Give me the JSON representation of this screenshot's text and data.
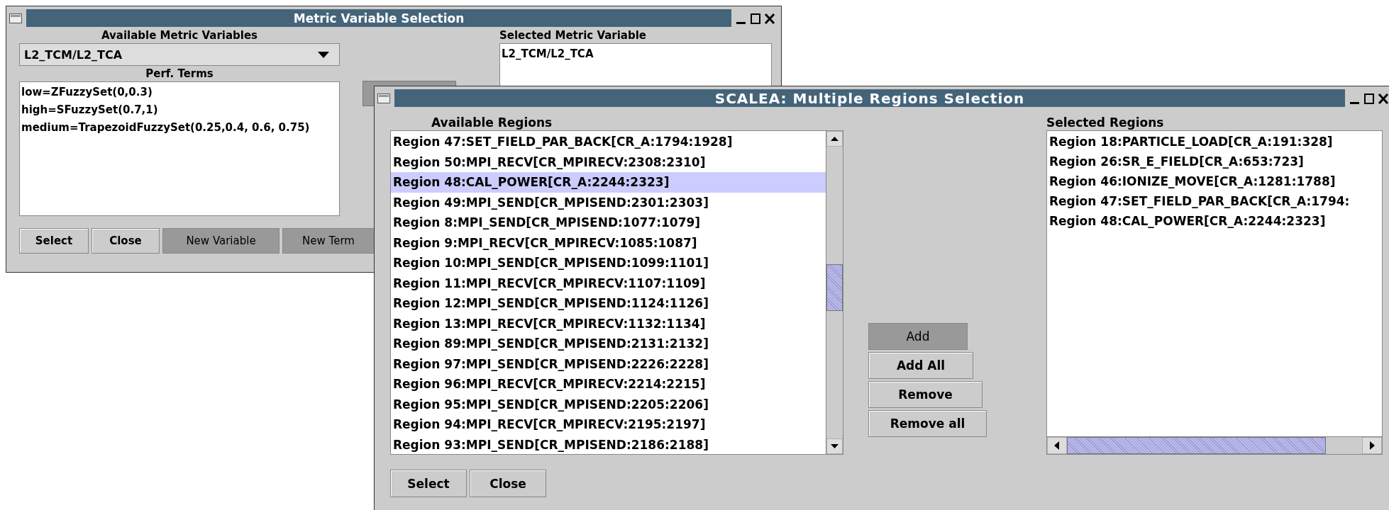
{
  "back_window": {
    "title": "Metric Variable Selection",
    "available_label": "Available Metric Variables",
    "dropdown": {
      "value": "L2_TCM/L2_TCA"
    },
    "perf_terms_label": "Perf. Terms",
    "perf_terms": [
      "low=ZFuzzySet(0,0.3)",
      "high=SFuzzySet(0.7,1)",
      "medium=TrapezoidFuzzySet(0.25,0.4, 0.6, 0.75)"
    ],
    "buttons": [
      {
        "label": "Select",
        "pressed": false
      },
      {
        "label": "Close",
        "pressed": false
      },
      {
        "label": "New Variable",
        "pressed": true
      },
      {
        "label": "New Term",
        "pressed": true
      }
    ],
    "selected_label": "Selected Metric Variable",
    "selected_items": [
      "L2_TCM/L2_TCA"
    ]
  },
  "front_window": {
    "title": "SCALEA: Multiple Regions Selection",
    "available_label": "Available Regions",
    "available_regions": [
      {
        "label": "Region 47:SET_FIELD_PAR_BACK[CR_A:1794:1928]",
        "selected": false
      },
      {
        "label": "Region 50:MPI_RECV[CR_MPIRECV:2308:2310]",
        "selected": false
      },
      {
        "label": "Region 48:CAL_POWER[CR_A:2244:2323]",
        "selected": true
      },
      {
        "label": "Region 49:MPI_SEND[CR_MPISEND:2301:2303]",
        "selected": false
      },
      {
        "label": "Region 8:MPI_SEND[CR_MPISEND:1077:1079]",
        "selected": false
      },
      {
        "label": "Region 9:MPI_RECV[CR_MPIRECV:1085:1087]",
        "selected": false
      },
      {
        "label": "Region 10:MPI_SEND[CR_MPISEND:1099:1101]",
        "selected": false
      },
      {
        "label": "Region 11:MPI_RECV[CR_MPIRECV:1107:1109]",
        "selected": false
      },
      {
        "label": "Region 12:MPI_SEND[CR_MPISEND:1124:1126]",
        "selected": false
      },
      {
        "label": "Region 13:MPI_RECV[CR_MPIRECV:1132:1134]",
        "selected": false
      },
      {
        "label": "Region 89:MPI_SEND[CR_MPISEND:2131:2132]",
        "selected": false
      },
      {
        "label": "Region 97:MPI_SEND[CR_MPISEND:2226:2228]",
        "selected": false
      },
      {
        "label": "Region 96:MPI_RECV[CR_MPIRECV:2214:2215]",
        "selected": false
      },
      {
        "label": "Region 95:MPI_SEND[CR_MPISEND:2205:2206]",
        "selected": false
      },
      {
        "label": "Region 94:MPI_RECV[CR_MPIRECV:2195:2197]",
        "selected": false
      },
      {
        "label": "Region 93:MPI_SEND[CR_MPISEND:2186:2188]",
        "selected": false
      }
    ],
    "move_buttons": [
      {
        "label": "Add",
        "pressed": true
      },
      {
        "label": "Add All",
        "pressed": false
      },
      {
        "label": "Remove",
        "pressed": false
      },
      {
        "label": "Remove all",
        "pressed": false
      }
    ],
    "selected_label": "Selected Regions",
    "selected_regions": [
      "Region 18:PARTICLE_LOAD[CR_A:191:328]",
      "Region 26:SR_E_FIELD[CR_A:653:723]",
      "Region 46:IONIZE_MOVE[CR_A:1281:1788]",
      "Region 47:SET_FIELD_PAR_BACK[CR_A:1794:",
      "Region 48:CAL_POWER[CR_A:2244:2323]"
    ],
    "buttons": [
      {
        "label": "Select",
        "pressed": false
      },
      {
        "label": "Close",
        "pressed": false
      }
    ]
  }
}
